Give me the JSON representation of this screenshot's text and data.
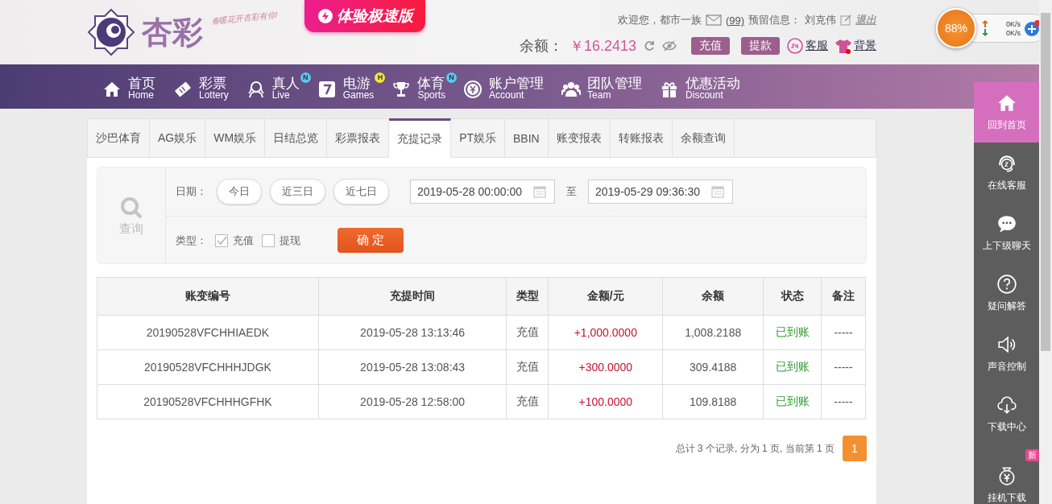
{
  "header": {
    "logo_text": "杏彩",
    "slogan": "春暖花开杏彩有你!",
    "speed_badge": "体验极速版",
    "welcome": "欢迎您，都市一族",
    "mail_count": "(99)",
    "reserved_label": "预留信息：",
    "reserved_name": "刘克伟",
    "logout": "退出",
    "balance_label": "余额：",
    "balance": "￥16.2413",
    "deposit": "充值",
    "withdraw": "提款",
    "service": "客服",
    "background": "背景"
  },
  "speed_widget": {
    "percent": "88%",
    "up": "0K/s",
    "down": "0K/s"
  },
  "nav": [
    {
      "kind": "home",
      "label": "首页",
      "sub": "Home"
    },
    {
      "kind": "ticket",
      "label": "彩票",
      "sub": "Lottery"
    },
    {
      "kind": "person",
      "label": "真人",
      "sub": "Live",
      "badge": "N",
      "color": "#5bc8f0"
    },
    {
      "kind": "seven",
      "label": "电游",
      "sub": "Games",
      "badge": "H",
      "color": "#f5e53c"
    },
    {
      "kind": "trophy",
      "label": "体育",
      "sub": "Sports",
      "badge": "N",
      "color": "#5bc8f0"
    },
    {
      "kind": "coin",
      "label": "账户管理",
      "sub": "Account"
    },
    {
      "kind": "team",
      "label": "团队管理",
      "sub": "Team"
    },
    {
      "kind": "gift",
      "label": "优惠活动",
      "sub": "Discount"
    }
  ],
  "tabs": [
    {
      "label": "沙巴体育",
      "selected": false
    },
    {
      "label": "AG娱乐",
      "selected": false
    },
    {
      "label": "WM娱乐",
      "selected": false
    },
    {
      "label": "日结总览",
      "selected": false
    },
    {
      "label": "彩票报表",
      "selected": false
    },
    {
      "label": "充提记录",
      "selected": true
    },
    {
      "label": "PT娱乐",
      "selected": false
    },
    {
      "label": "BBIN",
      "selected": false
    },
    {
      "label": "账变报表",
      "selected": false
    },
    {
      "label": "转账报表",
      "selected": false
    },
    {
      "label": "余额查询",
      "selected": false
    }
  ],
  "filter": {
    "search_label": "查询",
    "date_label": "日期：",
    "quick_ranges": [
      "今日",
      "近三日",
      "近七日"
    ],
    "start": "2019-05-28 00:00:00",
    "to": "至",
    "end": "2019-05-29 09:36:30",
    "type_label": "类型：",
    "types": [
      {
        "label": "充值",
        "checked": true
      },
      {
        "label": "提现",
        "checked": false
      }
    ],
    "confirm": "确 定"
  },
  "table": {
    "columns": [
      "账变编号",
      "充提时间",
      "类型",
      "金额/元",
      "余额",
      "状态",
      "备注"
    ],
    "rows": [
      [
        "20190528VFCHHIAEDK",
        "2019-05-28 13:13:46",
        "充值",
        "+1,000.0000",
        "1,008.2188",
        "已到账",
        "-----"
      ],
      [
        "20190528VFCHHHJDGK",
        "2019-05-28 13:08:43",
        "充值",
        "+300.0000",
        "309.4188",
        "已到账",
        "-----"
      ],
      [
        "20190528VFCHHHGFHK",
        "2019-05-28 12:58:00",
        "充值",
        "+100.0000",
        "109.8188",
        "已到账",
        "-----"
      ]
    ]
  },
  "pagination": {
    "summary": "总计 3 个记录, 分为 1 页, 当前第 1 页",
    "pages": [
      {
        "label": "1",
        "selected": true
      }
    ]
  },
  "side_menu": [
    {
      "kind": "home",
      "label": "回到首页",
      "selected": true
    },
    {
      "kind": "headset",
      "label": "在线客服",
      "selected": false
    },
    {
      "kind": "chat",
      "label": "上下级聊天",
      "selected": false
    },
    {
      "kind": "help",
      "label": "疑问解答",
      "selected": false
    },
    {
      "kind": "sound",
      "label": "声音控制",
      "selected": false
    },
    {
      "kind": "download",
      "label": "下载中心",
      "selected": false
    },
    {
      "kind": "moneybag",
      "label": "挂机下载",
      "selected": false,
      "badge": "新"
    }
  ]
}
